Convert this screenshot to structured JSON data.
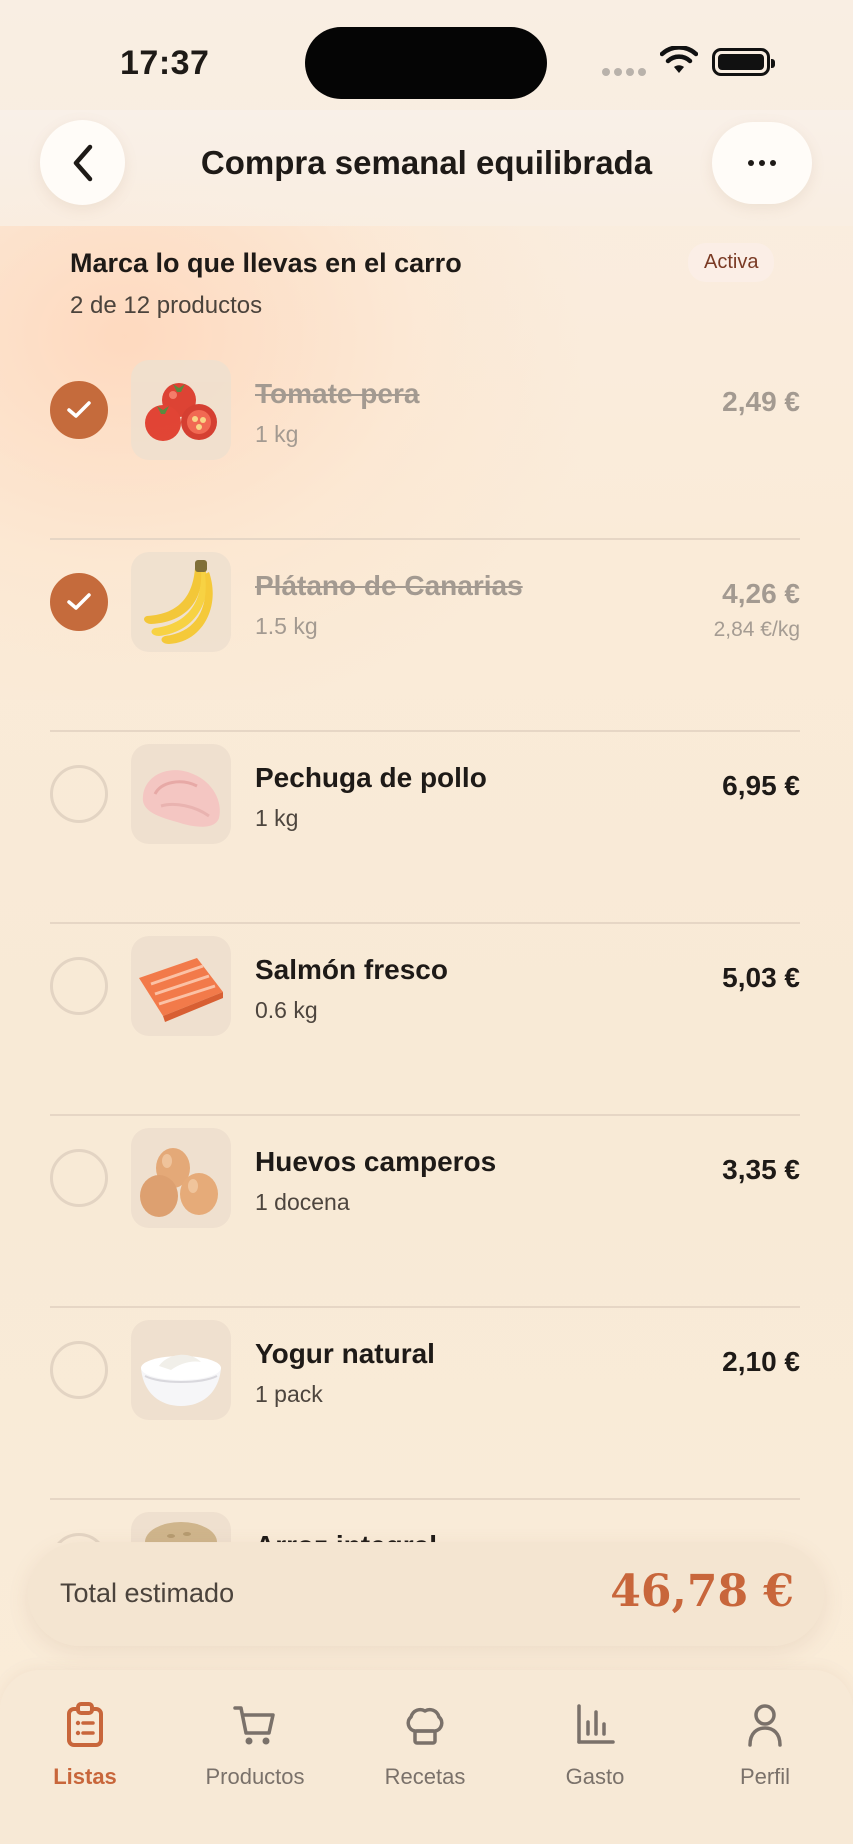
{
  "status": {
    "time": "17:37"
  },
  "header": {
    "title": "Compra semanal equilibrada",
    "back_icon": "chevron-left-icon",
    "more_icon": "ellipsis-icon"
  },
  "section": {
    "title": "Marca lo que llevas en el carro",
    "subtitle": "2 de 12 productos",
    "badge": "Activa"
  },
  "items": [
    {
      "name": "Tomate pera",
      "qty": "1 kg",
      "price": "2,49 €",
      "unit_price": "",
      "checked": true,
      "icon": "tomato-image"
    },
    {
      "name": "Plátano de Canarias",
      "qty": "1.5 kg",
      "price": "4,26 €",
      "unit_price": "2,84 €/kg",
      "checked": true,
      "icon": "banana-image"
    },
    {
      "name": "Pechuga de pollo",
      "qty": "1 kg",
      "price": "6,95 €",
      "unit_price": "",
      "checked": false,
      "icon": "chicken-breast-image"
    },
    {
      "name": "Salmón fresco",
      "qty": "0.6 kg",
      "price": "5,03 €",
      "unit_price": "",
      "checked": false,
      "icon": "salmon-image"
    },
    {
      "name": "Huevos camperos",
      "qty": "1 docena",
      "price": "3,35 €",
      "unit_price": "",
      "checked": false,
      "icon": "eggs-image"
    },
    {
      "name": "Yogur natural",
      "qty": "1 pack",
      "price": "2,10 €",
      "unit_price": "",
      "checked": false,
      "icon": "yogurt-image"
    },
    {
      "name": "Arroz integral",
      "qty": "",
      "price": "",
      "unit_price": "",
      "checked": false,
      "icon": "rice-image"
    }
  ],
  "total": {
    "label": "Total estimado",
    "value": "46,78 €"
  },
  "tabs": [
    {
      "label": "Listas",
      "icon": "clipboard-list-icon",
      "active": true
    },
    {
      "label": "Productos",
      "icon": "cart-icon",
      "active": false
    },
    {
      "label": "Recetas",
      "icon": "chef-hat-icon",
      "active": false
    },
    {
      "label": "Gasto",
      "icon": "bar-chart-icon",
      "active": false
    },
    {
      "label": "Perfil",
      "icon": "person-icon",
      "active": false
    }
  ],
  "colors": {
    "accent": "#c8663b",
    "check": "#c56b3c",
    "background": "#faecd9"
  }
}
